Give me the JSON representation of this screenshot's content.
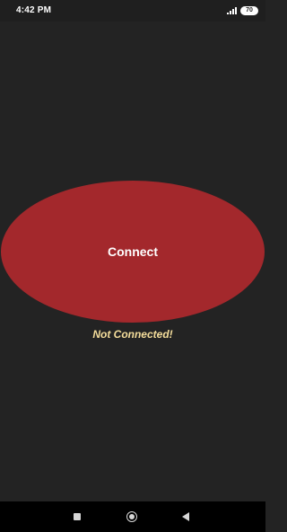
{
  "status_bar": {
    "time": "4:42 PM",
    "battery_level": "70",
    "icons": [
      "signal-icon",
      "battery-icon"
    ]
  },
  "main": {
    "connect_button_label": "Connect",
    "connection_status": "Not Connected!",
    "colors": {
      "background": "#232323",
      "button": "#a3282c",
      "status_text": "#f4dd9b"
    }
  },
  "nav_bar": {
    "icons": [
      "recents-icon",
      "home-icon",
      "back-icon"
    ]
  }
}
